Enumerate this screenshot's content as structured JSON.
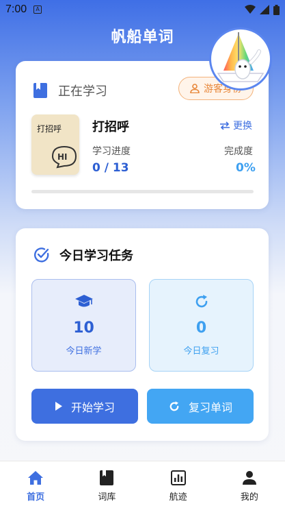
{
  "status_bar": {
    "time": "7:00",
    "notif_icon": "A"
  },
  "app": {
    "title": "帆船单词"
  },
  "current": {
    "header_label": "正在学习",
    "guest_label": "游客身份",
    "cover_text": "打招呼",
    "cover_bubble": "HI",
    "word": "打招呼",
    "switch_label": "更换",
    "progress_label": "学习进度",
    "progress_value": "0 / 13",
    "completion_label": "完成度",
    "completion_value": "0%",
    "progress_fraction": 0
  },
  "tasks": {
    "title": "今日学习任务",
    "new": {
      "count": "10",
      "label": "今日新学"
    },
    "review": {
      "count": "0",
      "label": "今日复习"
    },
    "start_button": "开始学习",
    "review_button": "复习单词"
  },
  "tabbar": {
    "items": [
      {
        "label": "首页",
        "icon": "home-icon",
        "active": true
      },
      {
        "label": "词库",
        "icon": "book-icon",
        "active": false
      },
      {
        "label": "航迹",
        "icon": "chart-icon",
        "active": false
      },
      {
        "label": "我的",
        "icon": "person-icon",
        "active": false
      }
    ]
  },
  "colors": {
    "primary": "#3e6fe0",
    "accent": "#43a6f3",
    "guest": "#e8873a"
  }
}
